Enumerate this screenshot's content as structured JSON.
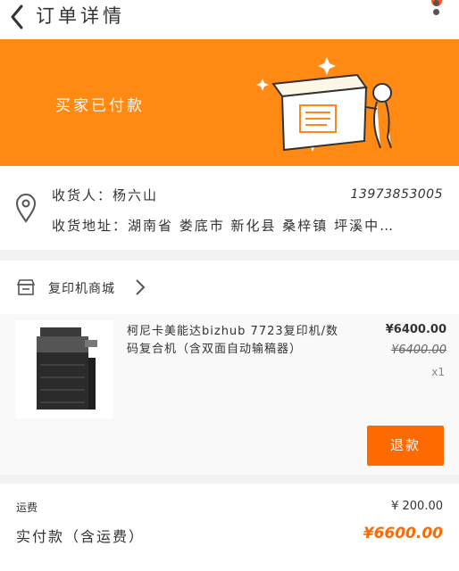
{
  "header": {
    "title": "订单详情"
  },
  "banner": {
    "status": "买家已付款"
  },
  "address": {
    "receiver": "收货人：杨六山",
    "phone": "13973853005",
    "address": "收货地址：湖南省 娄底市 新化县 桑梓镇 坪溪中…"
  },
  "shop": {
    "name": "复印机商城"
  },
  "item": {
    "name": "柯尼卡美能达bizhub 7723复印机/数码复合机（含双面自动输稿器）",
    "price": "¥6400.00",
    "original_price": "¥6400.00",
    "quantity": "x1",
    "refund_label": "退款"
  },
  "summary": {
    "shipping_label": "运费",
    "shipping_value": "¥ 200.00",
    "total_label": "实付款（含运费）",
    "total_value": "¥6600.00"
  },
  "colors": {
    "accent": "#fe8a14",
    "button": "#ff6a00"
  }
}
